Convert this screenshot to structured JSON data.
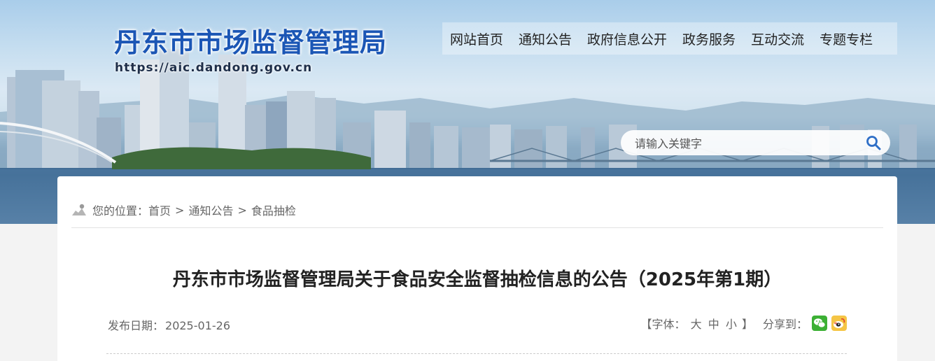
{
  "header": {
    "site_title": "丹东市市场监督管理局",
    "site_url": "https://aic.dandong.gov.cn",
    "nav": [
      {
        "label": "网站首页"
      },
      {
        "label": "通知公告"
      },
      {
        "label": "政府信息公开"
      },
      {
        "label": "政务服务"
      },
      {
        "label": "互动交流"
      },
      {
        "label": "专题专栏"
      }
    ],
    "search": {
      "placeholder": "请输入关键字",
      "value": ""
    }
  },
  "breadcrumb": {
    "prefix": "您的位置：",
    "items": [
      "首页",
      "通知公告",
      "食品抽检"
    ],
    "separator": ">"
  },
  "article": {
    "title": "丹东市市场监督管理局关于食品安全监督抽检信息的公告（2025年第1期）",
    "date_label": "发布日期：",
    "date": "2025-01-26",
    "font_open": "【字体：",
    "font_large": "大",
    "font_medium": "中",
    "font_small": "小",
    "font_close": "】",
    "share_label": "分享到："
  },
  "icons": {
    "location": "map-pin-icon",
    "search": "search-icon",
    "wechat": "wechat-icon",
    "weibo": "weibo-icon"
  },
  "colors": {
    "title_blue": "#1b56b5",
    "wechat_green": "#3cb034",
    "weibo_yellow": "#f5c545"
  }
}
